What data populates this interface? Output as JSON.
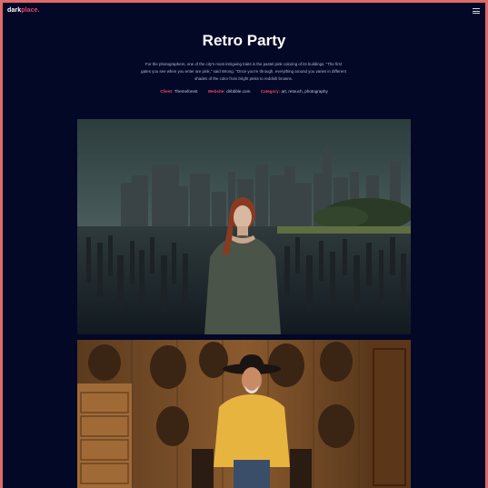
{
  "header": {
    "logo_main": "dark",
    "logo_accent": "place.",
    "menu_icon": "hamburger-menu-icon"
  },
  "project": {
    "title": "Retro Party",
    "description_lines": [
      "For the photographers, one of the city's most intriguing traits is the pastel pink coloring of its buildings. \"The first",
      "gates you see when you enter are pink,\" said Wrong. \"Once you're through, everything around you varies in different",
      "shades of the color from bright pinks to reddish browns."
    ],
    "meta": {
      "client_label": "Client:",
      "client_value": "Themeforest",
      "website_label": "Website:",
      "website_value": "dribbble.com",
      "category_label": "Category:",
      "category_value": "art, retouch, photography"
    }
  },
  "colors": {
    "background": "#020826",
    "accent": "#e94a6a",
    "border": "#e06a6a"
  }
}
